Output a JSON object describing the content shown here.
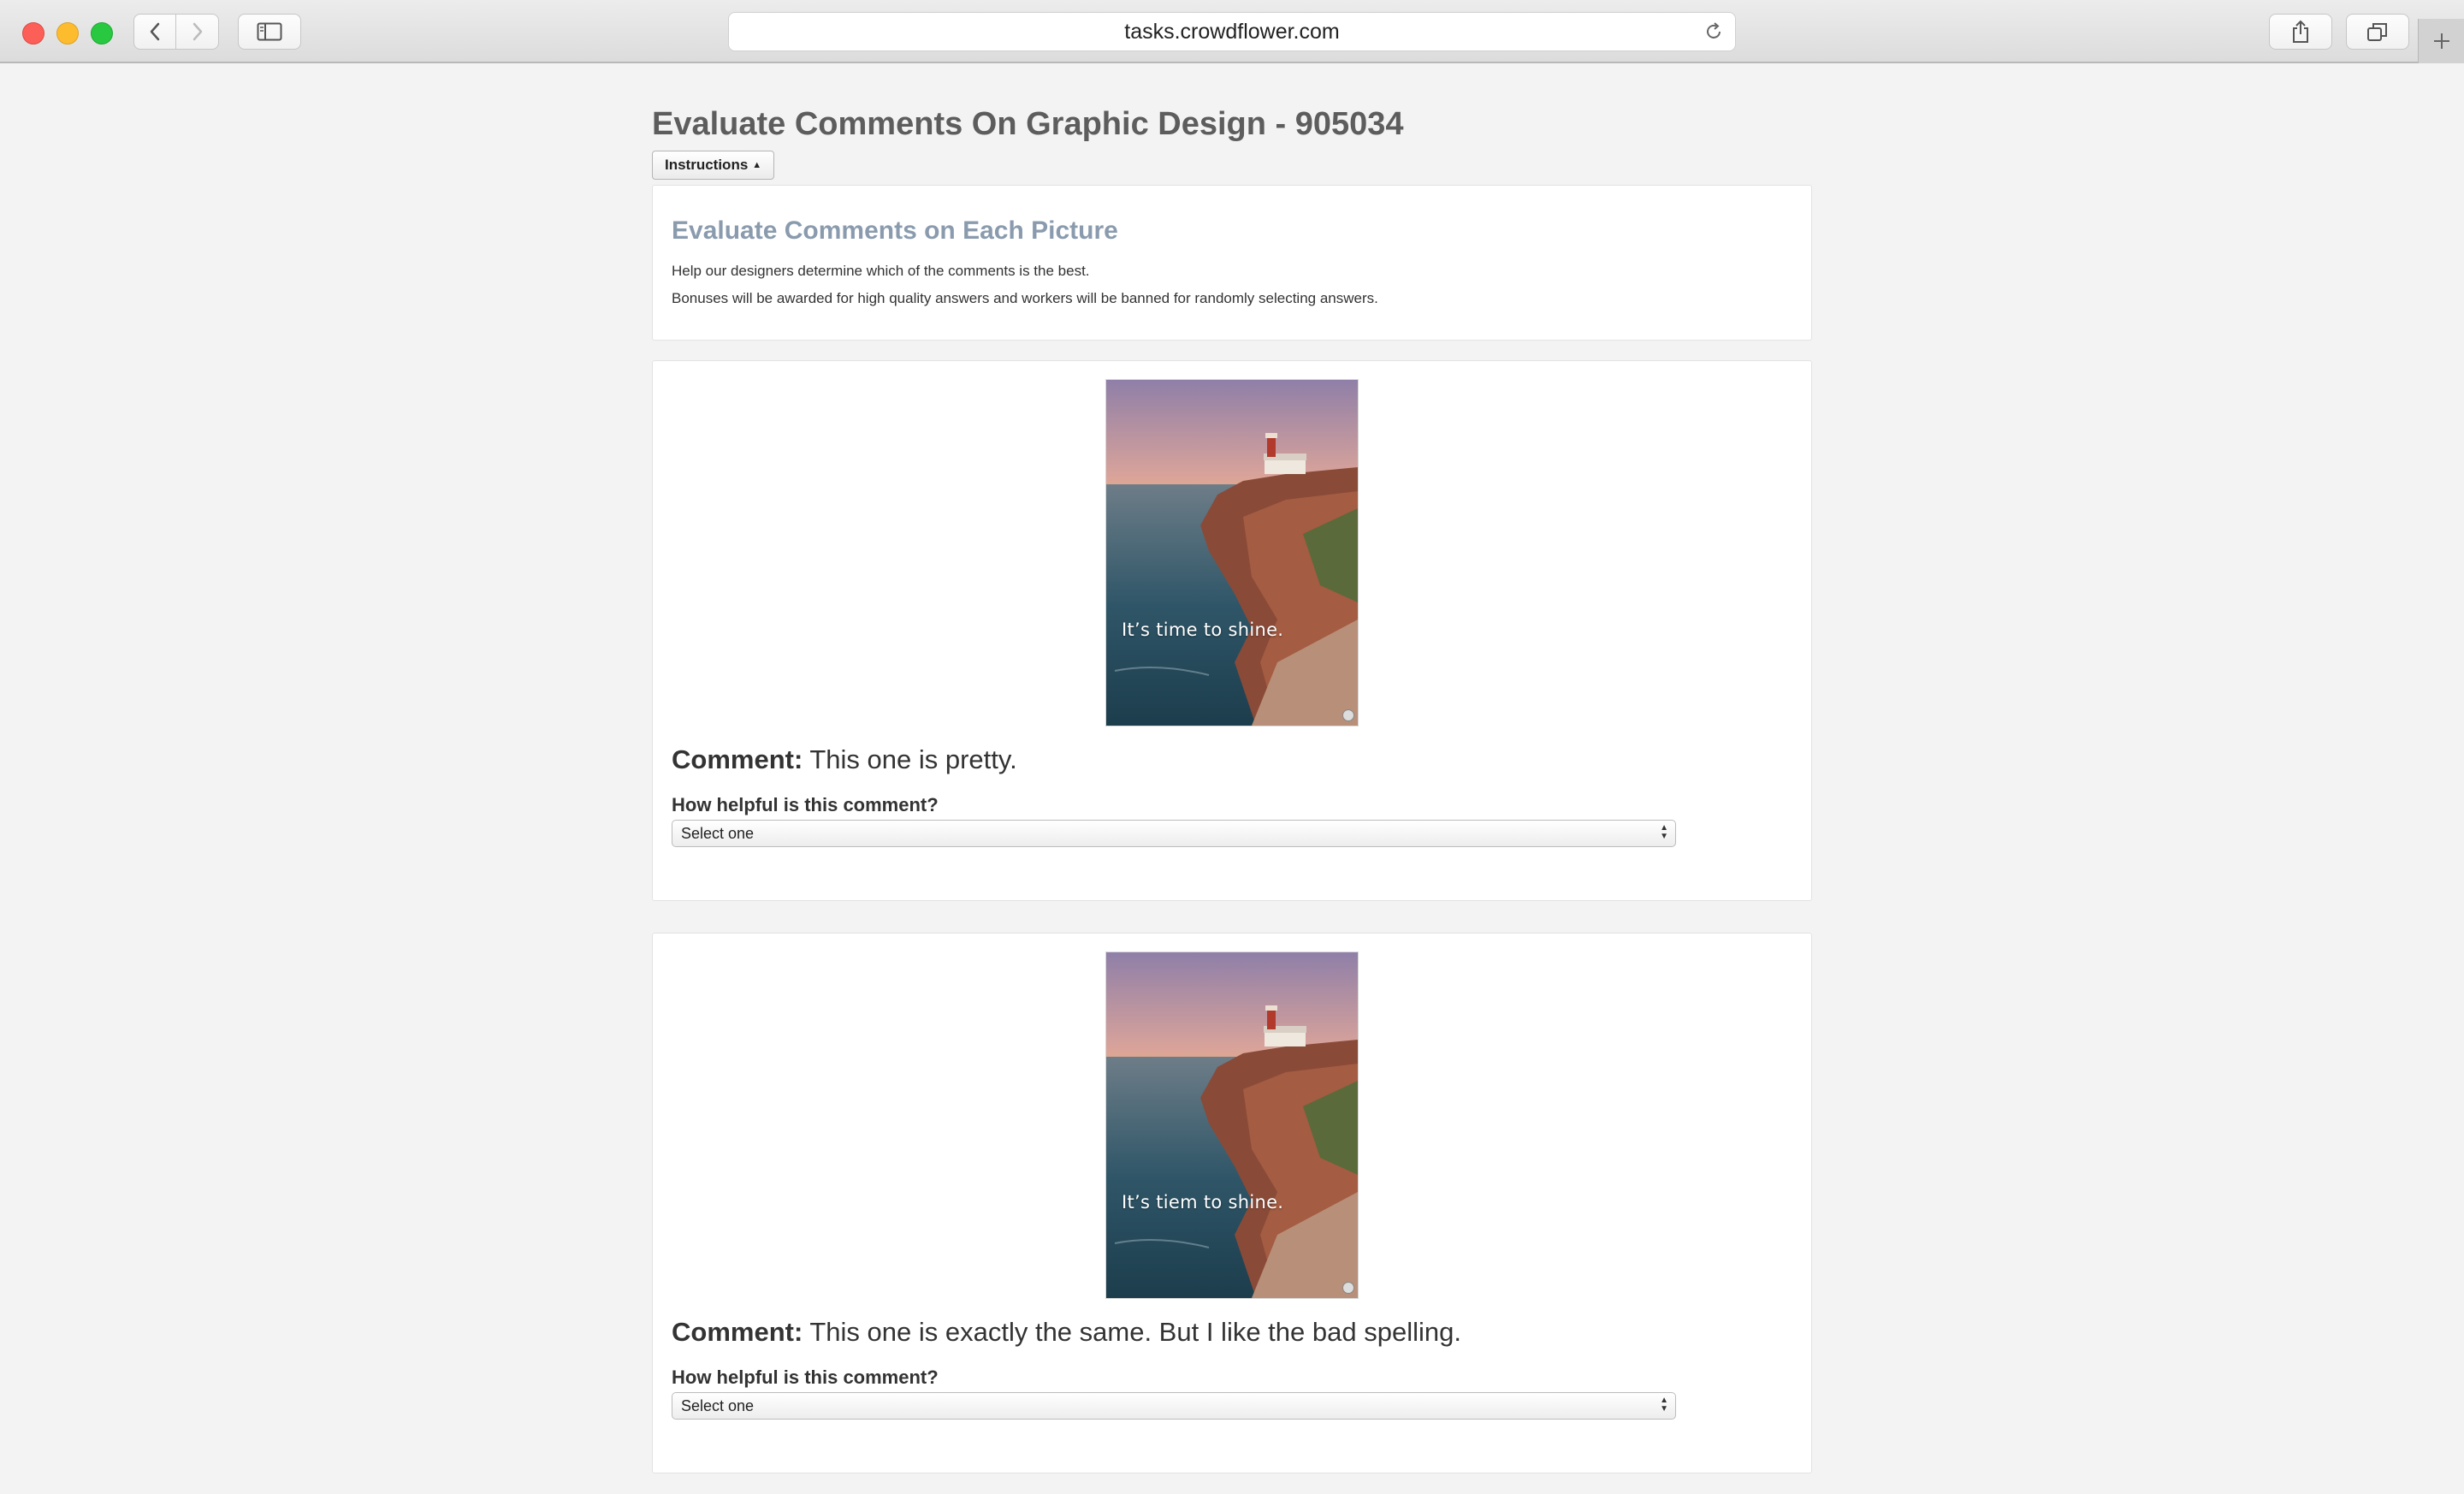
{
  "browser": {
    "url": "tasks.crowdflower.com"
  },
  "page": {
    "title": "Evaluate Comments On Graphic Design - 905034",
    "instructions_button": "Instructions"
  },
  "instructions": {
    "heading": "Evaluate Comments on Each Picture",
    "lines": [
      "Help our designers determine which of the comments is the best.",
      "Bonuses will be awarded for high quality answers and workers will be banned for randomly selecting answers."
    ]
  },
  "units": [
    {
      "image_caption": "It’s time to shine.",
      "comment_label": "Comment:",
      "comment_text": "This one is pretty.",
      "question": "How helpful is this comment?",
      "select_value": "Select one"
    },
    {
      "image_caption": "It’s tiem to shine.",
      "comment_label": "Comment:",
      "comment_text": "This one is exactly the same. But I like the bad spelling.",
      "question": "How helpful is this comment?",
      "select_value": "Select one"
    }
  ],
  "icons": {
    "back": "chevron-left-icon",
    "forward": "chevron-right-icon",
    "sidebar": "sidebar-icon",
    "reload": "reload-icon",
    "share": "share-icon",
    "tabs": "tabs-icon",
    "new_tab": "plus-icon"
  }
}
